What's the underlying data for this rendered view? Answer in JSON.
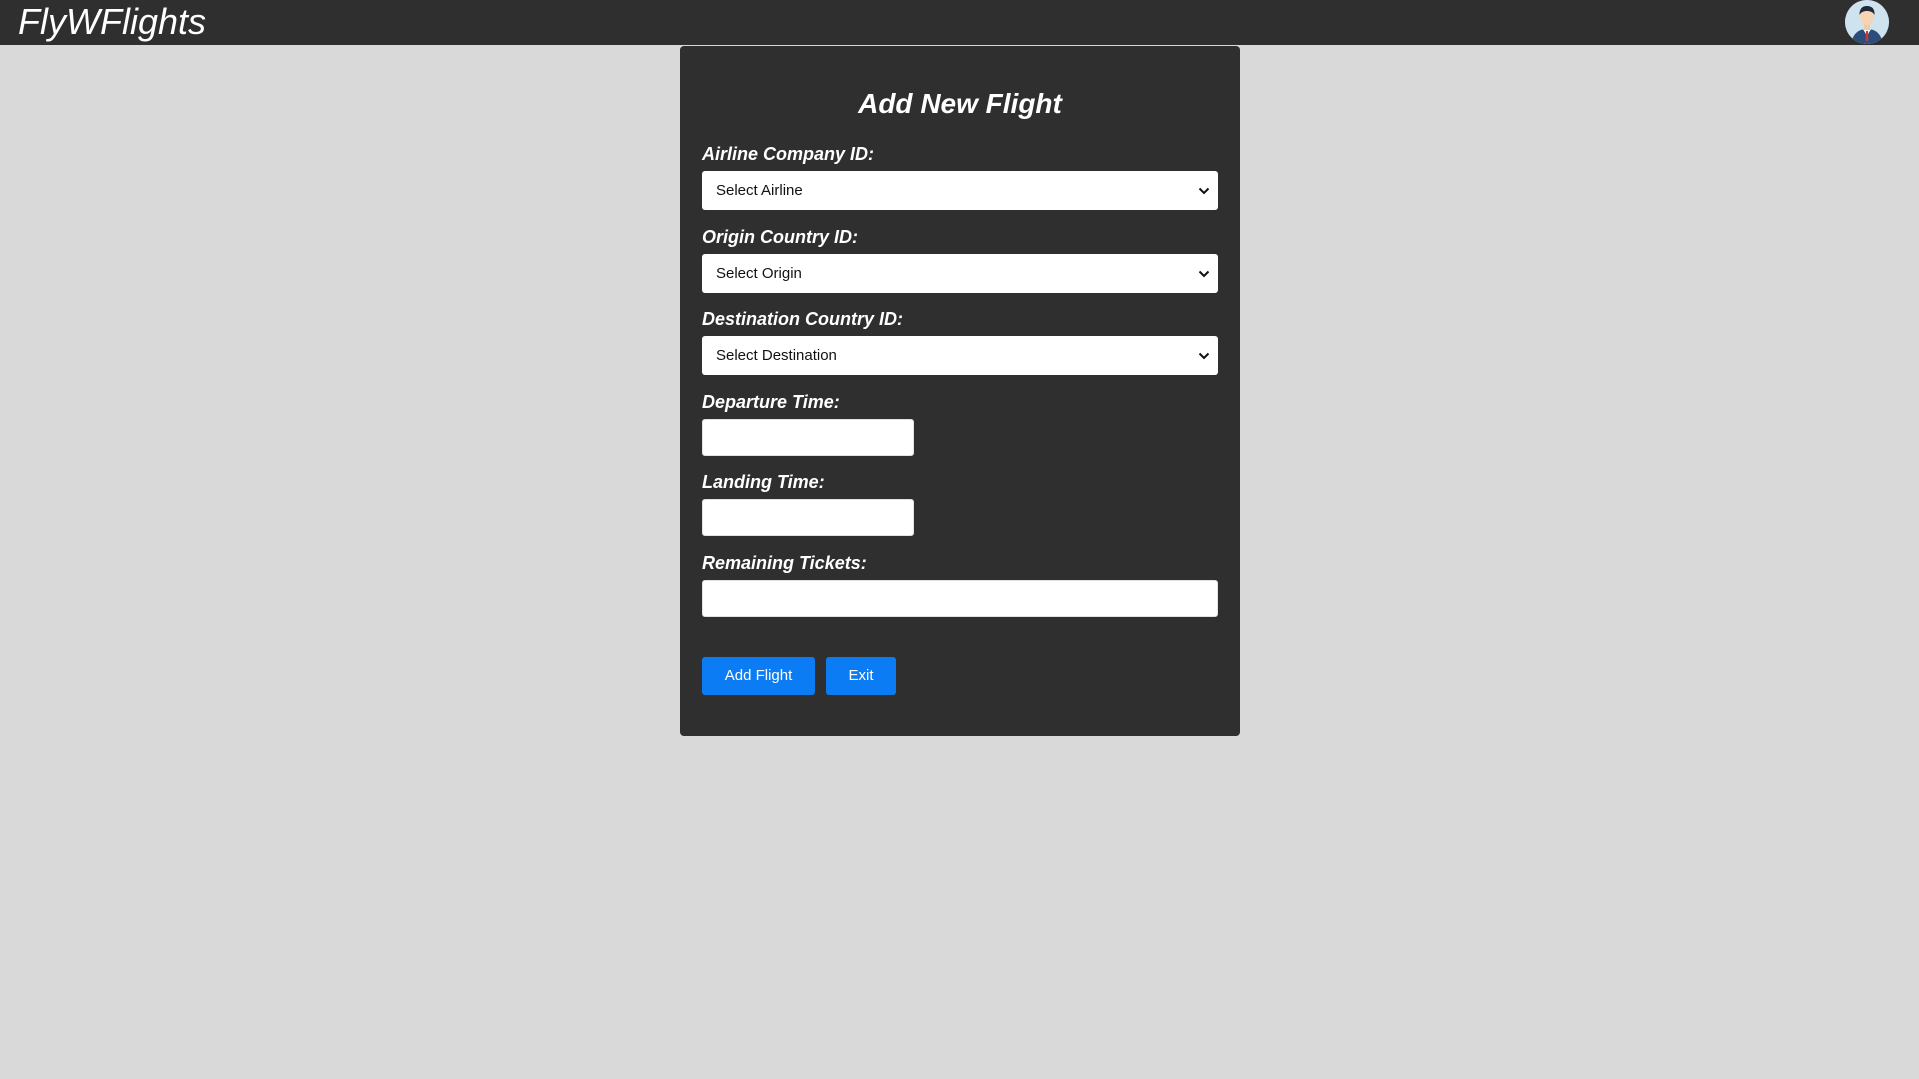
{
  "app": {
    "brand": "FlyWFlights"
  },
  "form": {
    "title": "Add New Flight",
    "fields": {
      "airline": {
        "label": "Airline Company ID:",
        "selected": "Select Airline"
      },
      "origin": {
        "label": "Origin Country ID:",
        "selected": "Select Origin"
      },
      "destination": {
        "label": "Destination Country ID:",
        "selected": "Select Destination"
      },
      "departure": {
        "label": "Departure Time:",
        "value": ""
      },
      "landing": {
        "label": "Landing Time:",
        "value": ""
      },
      "tickets": {
        "label": "Remaining Tickets:",
        "value": ""
      }
    },
    "buttons": {
      "add": "Add Flight",
      "exit": "Exit"
    }
  },
  "colors": {
    "topbar": "#2f2f2f",
    "card": "#2f2f2f",
    "background": "#d9d9d9",
    "button": "#0b7cf3"
  },
  "icons": {
    "avatar": "user-avatar-icon",
    "chevron": "chevron-down-icon"
  }
}
